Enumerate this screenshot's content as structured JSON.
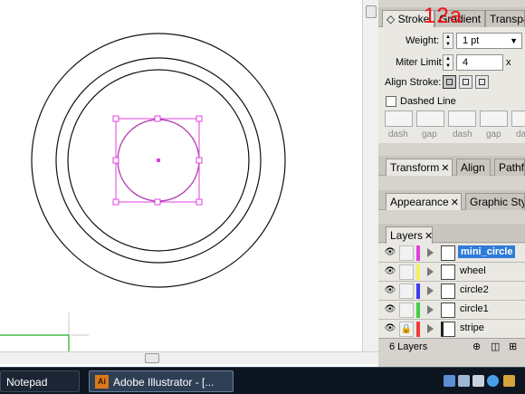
{
  "overlay_label": "12a",
  "stroke_panel": {
    "tabs": [
      "Stroke",
      "Gradient",
      "Transpa"
    ],
    "weight_label": "Weight:",
    "weight_value": "1 pt",
    "miter_label": "Miter Limit:",
    "miter_value": "4",
    "miter_unit": "x",
    "align_label": "Align Stroke:",
    "dashed_label": "Dashed Line",
    "dash_labels": [
      "dash",
      "gap",
      "dash",
      "gap",
      "dash"
    ]
  },
  "transform_panel": {
    "tabs": [
      "Transform",
      "Align",
      "Pathfi"
    ]
  },
  "appearance_panel": {
    "tabs": [
      "Appearance",
      "Graphic Styl"
    ]
  },
  "layers_panel": {
    "tab": "Layers",
    "layers": [
      {
        "name": "mini_circle",
        "color": "#e040e0"
      },
      {
        "name": "wheel",
        "color": "#f0f060"
      },
      {
        "name": "circle2",
        "color": "#3c3cf0"
      },
      {
        "name": "circle1",
        "color": "#40d040"
      },
      {
        "name": "stripe",
        "color": "#f03c3c"
      }
    ],
    "footer": "6 Layers"
  },
  "taskbar": {
    "items": [
      "Notepad",
      "Adobe Illustrator - [..."
    ],
    "ai_icon_text": "Ai"
  },
  "icons": {
    "eye": "eye-icon",
    "lock": "lock-icon",
    "expand": "expand-triangle-icon"
  }
}
